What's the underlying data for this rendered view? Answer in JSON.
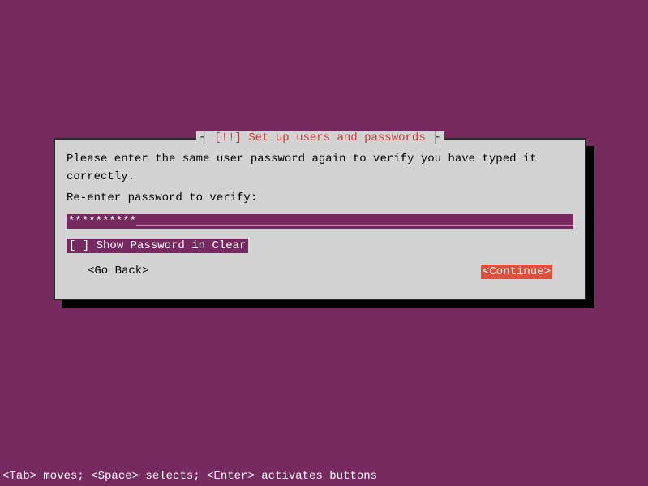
{
  "dialog": {
    "title_left_bracket": "┤ ",
    "title_bang": "[!!]",
    "title_text": " Set up users and passwords",
    "title_right_bracket": " ├",
    "instruction": "Please enter the same user password again to verify you have typed it correctly.",
    "field_label": "Re-enter password to verify:",
    "password_value": "**********",
    "password_fill": "_____________________________________________________________________",
    "checkbox_state": "[ ]",
    "checkbox_label": " Show Password in Clear",
    "go_back_label": "<Go Back>",
    "continue_label": "<Continue>"
  },
  "footer": {
    "help_text": "<Tab> moves; <Space> selects; <Enter> activates buttons"
  }
}
